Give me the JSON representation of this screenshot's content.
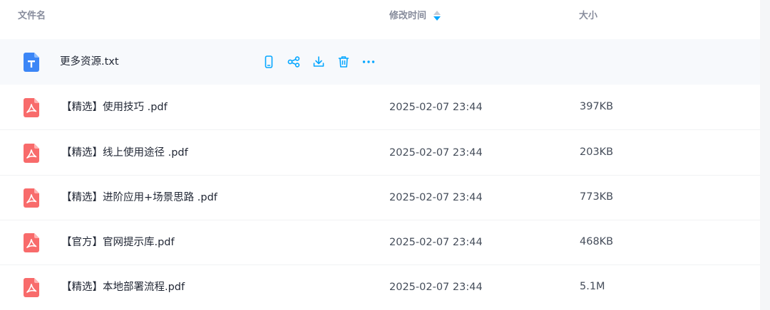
{
  "header": {
    "name_label": "文件名",
    "time_label": "修改时间",
    "size_label": "大小"
  },
  "colors": {
    "accent": "#06a7ff",
    "txt_icon": "#3c86f6",
    "pdf_icon": "#f86b6b",
    "hover_row": "#f7f9fc"
  },
  "files": [
    {
      "name": "更多资源.txt",
      "type": "txt",
      "time": "",
      "size": "",
      "icon": "txt-file-icon"
    },
    {
      "name": "【精选】使用技巧 .pdf",
      "type": "pdf",
      "time": "2025-02-07 23:44",
      "size": "397KB",
      "icon": "pdf-file-icon"
    },
    {
      "name": "【精选】线上使用途径 .pdf",
      "type": "pdf",
      "time": "2025-02-07 23:44",
      "size": "203KB",
      "icon": "pdf-file-icon"
    },
    {
      "name": "【精选】进阶应用+场景思路 .pdf",
      "type": "pdf",
      "time": "2025-02-07 23:44",
      "size": "773KB",
      "icon": "pdf-file-icon"
    },
    {
      "name": "【官方】官网提示库.pdf",
      "type": "pdf",
      "time": "2025-02-07 23:44",
      "size": "468KB",
      "icon": "pdf-file-icon"
    },
    {
      "name": "【精选】本地部署流程.pdf",
      "type": "pdf",
      "time": "2025-02-07 23:44",
      "size": "5.1M",
      "icon": "pdf-file-icon"
    }
  ],
  "row_actions": [
    "mobile-icon",
    "share-icon",
    "download-icon",
    "delete-icon",
    "more-icon"
  ],
  "sort": {
    "column": "time",
    "direction": "desc"
  }
}
